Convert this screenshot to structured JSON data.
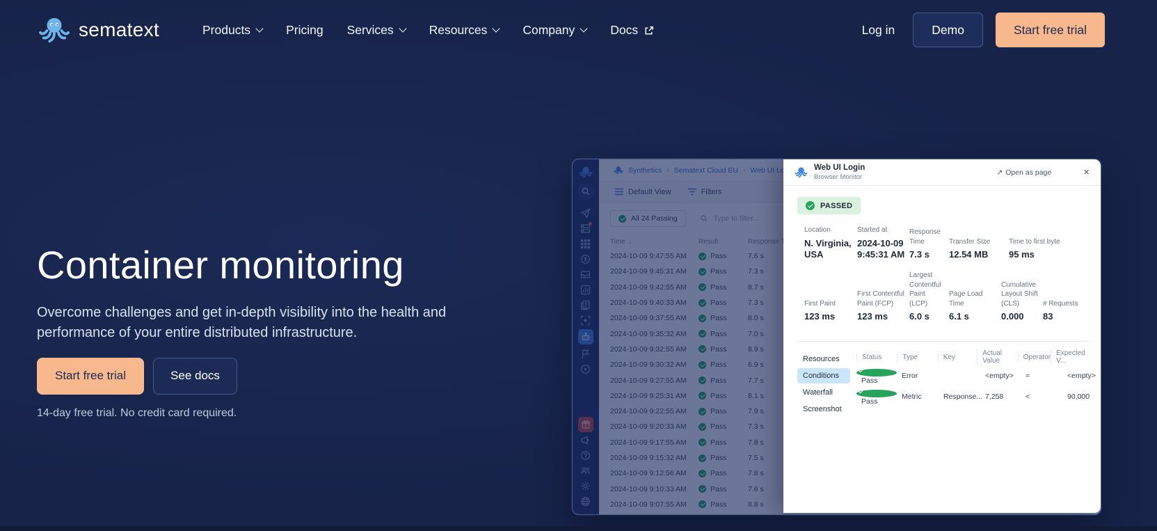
{
  "colors": {
    "background_navy": "#172349",
    "accent_salmon": "#f8b88e",
    "brand_blue": "#6db4ea",
    "app_accent_blue": "#3f82dd",
    "success_green": "#27a45c",
    "passed_badge_bg": "#d9f2df",
    "active_tab_bg": "#cae6fb",
    "gift_tile_red": "#c8473c"
  },
  "nav": {
    "brand": "sematext",
    "items": [
      {
        "label": "Products",
        "chevron": true,
        "external": false
      },
      {
        "label": "Pricing",
        "chevron": false,
        "external": false
      },
      {
        "label": "Services",
        "chevron": true,
        "external": false
      },
      {
        "label": "Resources",
        "chevron": true,
        "external": false
      },
      {
        "label": "Company",
        "chevron": true,
        "external": false
      },
      {
        "label": "Docs",
        "chevron": false,
        "external": true
      }
    ],
    "login_label": "Log in",
    "demo_label": "Demo",
    "trial_label": "Start free trial"
  },
  "hero": {
    "title": "Container monitoring",
    "description": "Overcome challenges and get in-depth visibility into the health and performance of your entire distributed infrastructure.",
    "primary_cta": "Start free trial",
    "secondary_cta": "See docs",
    "footnote": "14-day free trial. No credit card required."
  },
  "app": {
    "sidebar_icons": [
      "octopus-logo",
      "search",
      "paper-plane",
      "servers",
      "grid",
      "coin",
      "inbox",
      "bar-chart",
      "documents",
      "scan-target",
      "robot-synthetics",
      "flag",
      "circle-dot",
      "gift",
      "megaphone",
      "question-circle",
      "people",
      "gear",
      "globe"
    ],
    "breadcrumb": [
      "Synthetics",
      "Sematext Cloud EU",
      "Web UI Login"
    ],
    "crumb_sep": "›",
    "toolbar": {
      "view_label": "Default View",
      "filters_label": "Filters"
    },
    "status_chip": "All 24 Passing",
    "search_placeholder": "Type to filter...",
    "table": {
      "col_time": "Time",
      "sort_icon": "↓",
      "col_result": "Result",
      "col_response": "Response Time",
      "rows": [
        {
          "time": "2024-10-09 9:47:55 AM",
          "result": "Pass",
          "response": "7.6 s"
        },
        {
          "time": "2024-10-09 9:45:31 AM",
          "result": "Pass",
          "response": "7.3 s"
        },
        {
          "time": "2024-10-09 9:42:55 AM",
          "result": "Pass",
          "response": "8.7 s"
        },
        {
          "time": "2024-10-09 9:40:33 AM",
          "result": "Pass",
          "response": "7.3 s"
        },
        {
          "time": "2024-10-09 9:37:55 AM",
          "result": "Pass",
          "response": "8.0 s"
        },
        {
          "time": "2024-10-09 9:35:32 AM",
          "result": "Pass",
          "response": "7.0 s"
        },
        {
          "time": "2024-10-09 9:32:55 AM",
          "result": "Pass",
          "response": "8.9 s"
        },
        {
          "time": "2024-10-09 9:30:32 AM",
          "result": "Pass",
          "response": "6.9 s"
        },
        {
          "time": "2024-10-09 9:27:55 AM",
          "result": "Pass",
          "response": "7.7 s"
        },
        {
          "time": "2024-10-09 9:25:31 AM",
          "result": "Pass",
          "response": "8.1 s"
        },
        {
          "time": "2024-10-09 9:22:55 AM",
          "result": "Pass",
          "response": "7.9 s"
        },
        {
          "time": "2024-10-09 9:20:33 AM",
          "result": "Pass",
          "response": "7.3 s"
        },
        {
          "time": "2024-10-09 9:17:55 AM",
          "result": "Pass",
          "response": "7.8 s"
        },
        {
          "time": "2024-10-09 9:15:32 AM",
          "result": "Pass",
          "response": "7.5 s"
        },
        {
          "time": "2024-10-09 9:12:56 AM",
          "result": "Pass",
          "response": "7.8 s"
        },
        {
          "time": "2024-10-09 9:10:33 AM",
          "result": "Pass",
          "response": "7.6 s"
        },
        {
          "time": "2024-10-09 9:07:55 AM",
          "result": "Pass",
          "response": "8.8 s"
        }
      ]
    }
  },
  "panel": {
    "title": "Web UI Login",
    "subtitle": "Browser Monitor",
    "open_icon": "↗",
    "open_as_page": "Open as page",
    "close_icon": "×",
    "status": "PASSED",
    "metrics_row1": [
      {
        "label": "Location",
        "value": "N. Virginia, USA"
      },
      {
        "label": "Started at",
        "value": "2024-10-09 9:45:31 AM"
      },
      {
        "label": "Response Time",
        "value": "7.3 s"
      },
      {
        "label": "Transfer Size",
        "value": "12.54 MB"
      },
      {
        "label": "Time to first byte",
        "value": "95 ms"
      }
    ],
    "metrics_row2": [
      {
        "label": "First Paint",
        "value": "123 ms"
      },
      {
        "label": "First Contentful Paint (FCP)",
        "value": "123 ms"
      },
      {
        "label": "Largest Contentful Paint (LCP)",
        "value": "6.0 s"
      },
      {
        "label": "Page Load Time",
        "value": "6.1 s"
      },
      {
        "label": "Cumulative Layout Shift (CLS)",
        "value": "0.000"
      },
      {
        "label": "# Requests",
        "value": "83"
      }
    ],
    "tabs": [
      {
        "label": "Resources",
        "active": false
      },
      {
        "label": "Conditions",
        "active": true
      },
      {
        "label": "Waterfall",
        "active": false
      },
      {
        "label": "Screenshot",
        "active": false
      }
    ],
    "conditions": {
      "columns": [
        "Status",
        "Type",
        "Key",
        "Actual Value",
        "Operator",
        "Expected V..."
      ],
      "rows": [
        {
          "status": "Pass",
          "type": "Error",
          "key": "",
          "actual": "<empty>",
          "operator": "=",
          "expected": "<empty>"
        },
        {
          "status": "Pass",
          "type": "Metric",
          "key": "Response...",
          "actual": "7,258",
          "operator": "<",
          "expected": "90,000"
        }
      ]
    }
  }
}
